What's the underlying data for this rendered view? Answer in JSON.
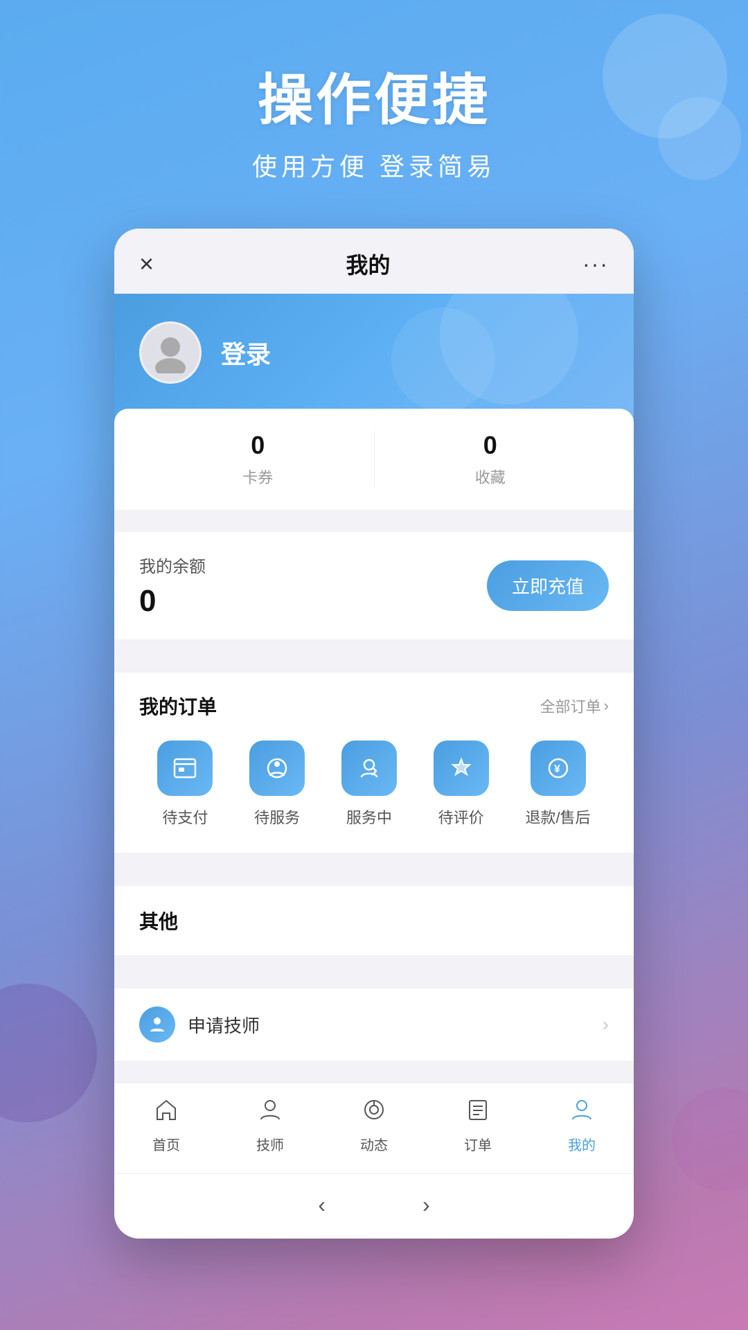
{
  "background": {
    "gradient": "linear-gradient(160deg, #5aabf0 0%, #6ab0f5 30%, #7b8fd4 60%, #b87ab0 90%, #c97ab5 100%)"
  },
  "header": {
    "title": "操作便捷",
    "subtitle": "使用方便   登录简易"
  },
  "phone": {
    "topBar": {
      "close": "×",
      "title": "我的",
      "menu": "···"
    },
    "profile": {
      "loginText": "登录"
    },
    "stats": [
      {
        "value": "0",
        "label": "卡券"
      },
      {
        "value": "0",
        "label": "收藏"
      }
    ],
    "balance": {
      "title": "我的余额",
      "amount": "0",
      "rechargeBtn": "立即充值"
    },
    "orders": {
      "title": "我的订单",
      "allText": "全部订单",
      "items": [
        {
          "icon": "💼",
          "label": "待支付"
        },
        {
          "icon": "📷",
          "label": "待服务"
        },
        {
          "icon": "👤",
          "label": "服务中"
        },
        {
          "icon": "❤️",
          "label": "待评价"
        },
        {
          "icon": "¥",
          "label": "退款/售后"
        }
      ]
    },
    "other": {
      "title": "其他"
    },
    "applyTechnician": {
      "text": "申请技师"
    },
    "bottomNav": [
      {
        "icon": "🏠",
        "label": "首页",
        "active": false
      },
      {
        "icon": "👤",
        "label": "技师",
        "active": false
      },
      {
        "icon": "💬",
        "label": "动态",
        "active": false
      },
      {
        "icon": "📋",
        "label": "订单",
        "active": false
      },
      {
        "icon": "👤",
        "label": "我的",
        "active": true
      }
    ],
    "navArrows": {
      "back": "‹",
      "forward": "›"
    }
  }
}
